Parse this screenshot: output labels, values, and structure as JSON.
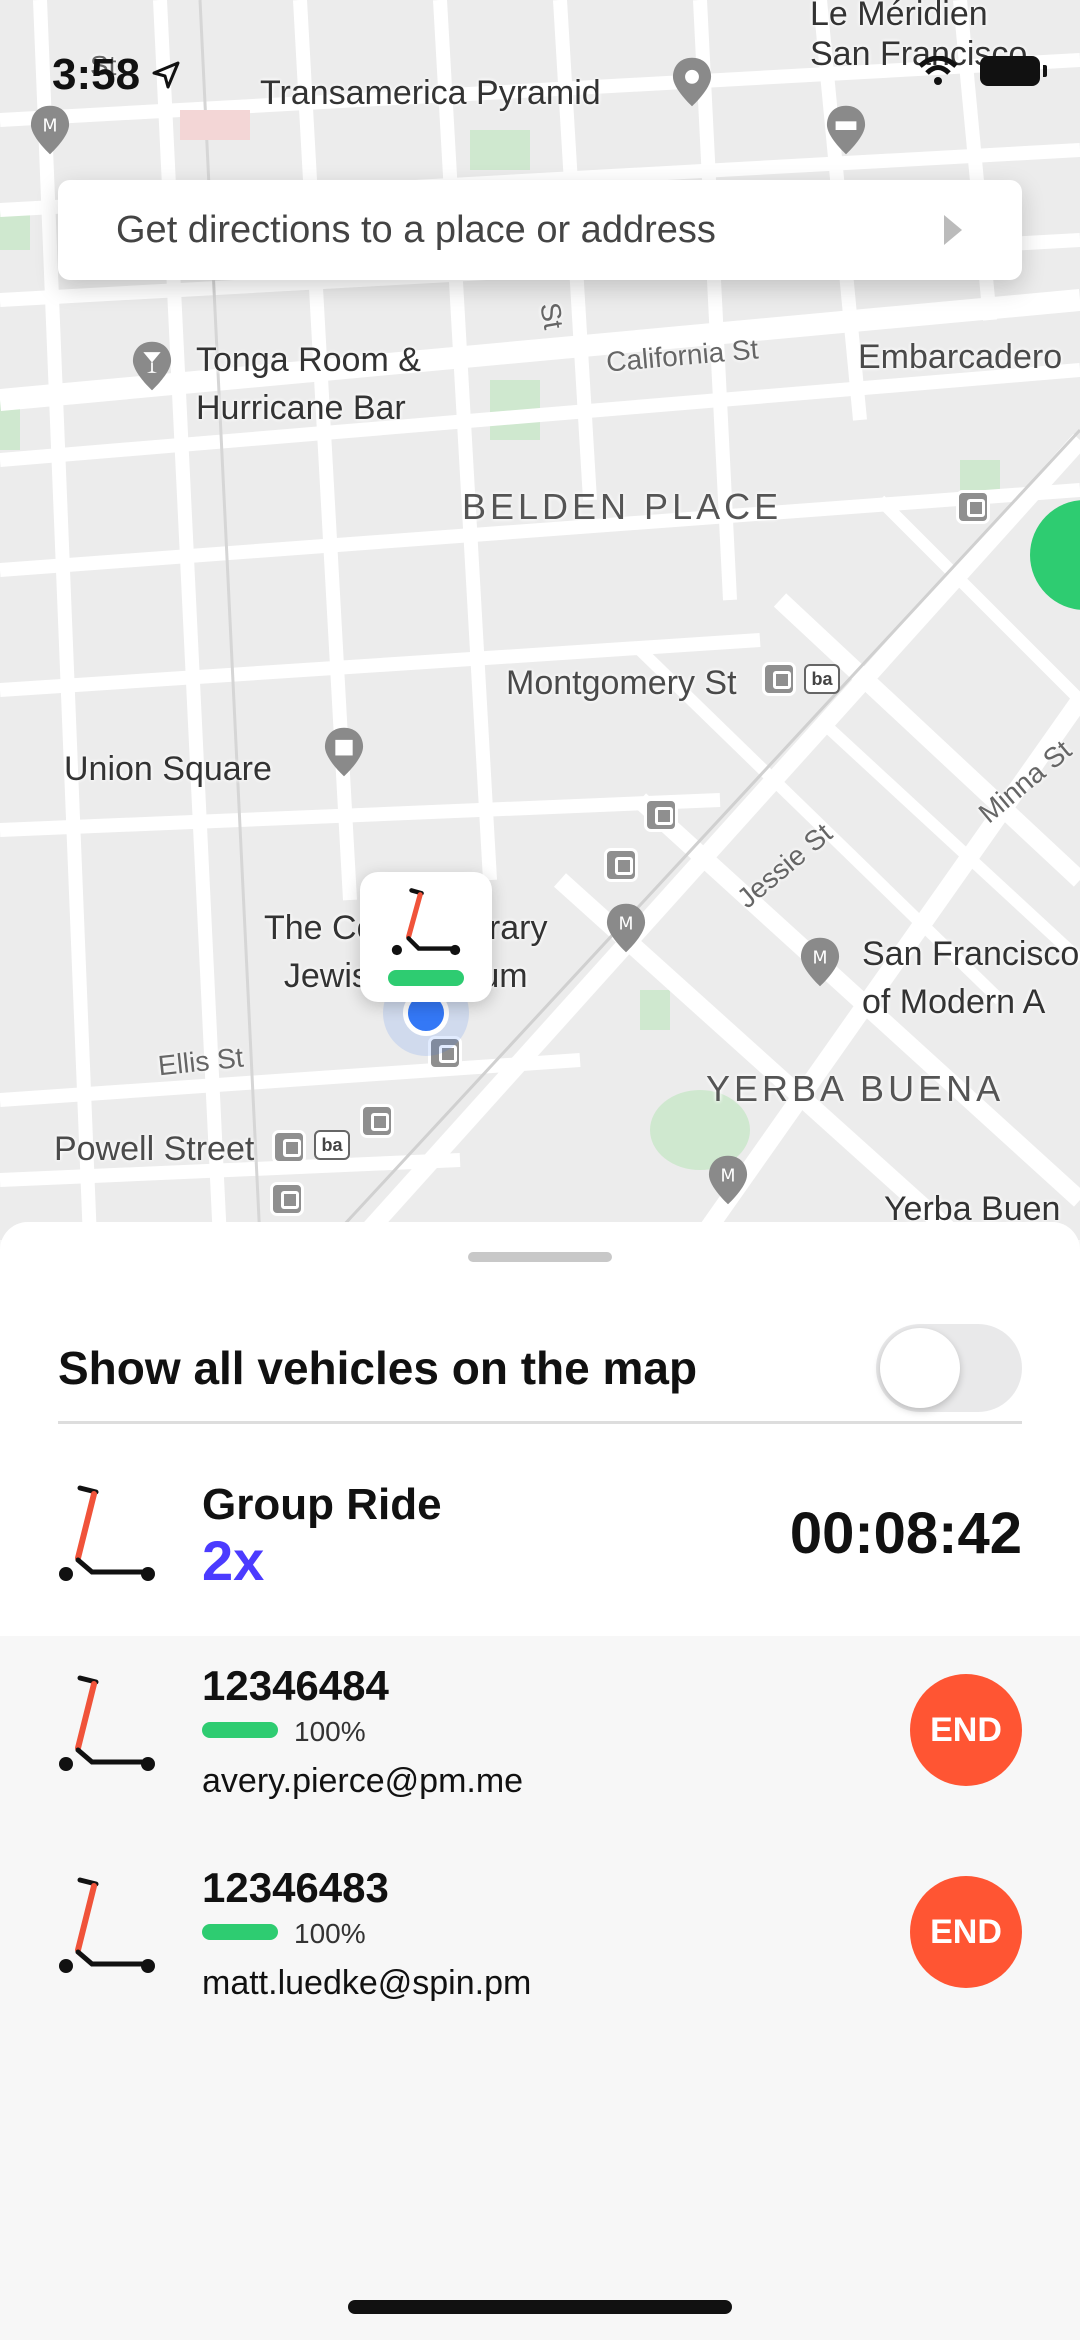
{
  "status_bar": {
    "time": "3:58"
  },
  "search": {
    "placeholder": "Get directions to a place or address"
  },
  "map": {
    "labels": {
      "transamerica": "Transamerica Pyramid",
      "le_meridien": "Le Méridien\nSan Francisco",
      "tonga": "Tonga Room &\nHurricane Bar",
      "california": "California St",
      "embarcadero": "Embarcadero",
      "belden": "BELDEN PLACE",
      "montgomery": "Montgomery St",
      "union_square": "Union Square",
      "jessie": "Jessie St",
      "minna": "Minna St",
      "museum": "The Contemporary\nJewish Museum",
      "sfmoma": "San Francisco\nof Modern A",
      "ellis": "Ellis St",
      "yerba": "YERBA BUENA",
      "powell": "Powell Street",
      "yerba_buena_2": "Yerba Buen",
      "st_top": "St",
      "st_right": "St"
    }
  },
  "sheet": {
    "toggle_label": "Show all vehicles on the map",
    "group": {
      "title": "Group Ride",
      "multiplier": "2x",
      "timer": "00:08:42"
    },
    "riders": [
      {
        "vehicle_id": "12346484",
        "battery": "100%",
        "email": "avery.pierce@pm.me",
        "end_label": "END"
      },
      {
        "vehicle_id": "12346483",
        "battery": "100%",
        "email": "matt.luedke@spin.pm",
        "end_label": "END"
      }
    ]
  },
  "colors": {
    "accent": "#4b3bff",
    "end_button": "#ff5533",
    "battery": "#2ecc71"
  }
}
